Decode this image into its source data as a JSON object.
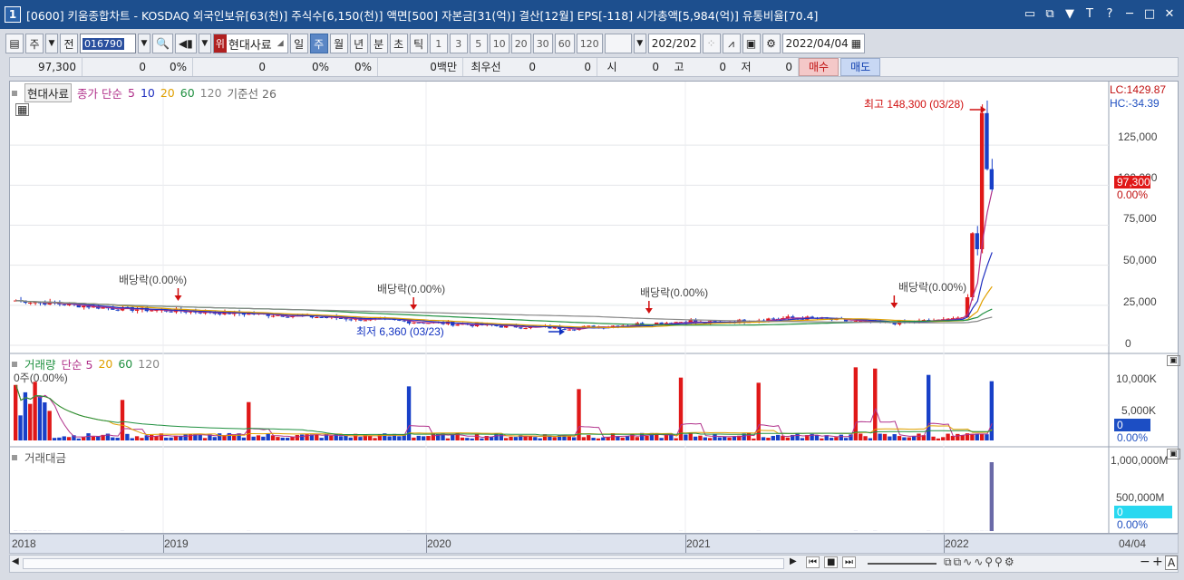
{
  "window": {
    "number": "1",
    "title": "[0600] 키움종합차트 - KOSDAQ 외국인보유[63(천)] 주식수[6,150(천)] 액면[500] 자본금[31(억)] 결산[12월] EPS[-118] 시가총액[5,984(억)] 유통비율[70.4]",
    "controls": [
      "▭",
      "⧉",
      "▼",
      "T",
      "?",
      "─",
      "□",
      "✕"
    ]
  },
  "toolbar": {
    "type_label": "주",
    "prev_label": "전",
    "code_value": "016790",
    "stock_badge": "위",
    "stock_name": "현대사료",
    "periods": [
      "일",
      "주",
      "월",
      "년",
      "분",
      "초",
      "틱"
    ],
    "active_period": "주",
    "multipliers": [
      "1",
      "3",
      "5",
      "10",
      "20",
      "30",
      "60",
      "120"
    ],
    "count": "202",
    "count_total": "/202",
    "date": "2022/04/04"
  },
  "quote": {
    "price": "97,300",
    "change1": "0",
    "pct1": "0%",
    "vol": "0",
    "pct2": "0%",
    "pct3": "0%",
    "amount": "0백만",
    "best_label": "최우선",
    "best1": "0",
    "best2": "0",
    "open_label": "시",
    "open": "0",
    "high_label": "고",
    "high": "0",
    "low_label": "저",
    "low": "0",
    "buy": "매수",
    "sell": "매도"
  },
  "price_panel": {
    "name": "현대사료",
    "legend": [
      {
        "label": "종가 단순",
        "color": "#b0308a"
      },
      {
        "label": "5",
        "color": "#b0308a"
      },
      {
        "label": "10",
        "color": "#2030c0"
      },
      {
        "label": "20",
        "color": "#e0a000"
      },
      {
        "label": "60",
        "color": "#209040"
      },
      {
        "label": "120",
        "color": "#888888"
      },
      {
        "label": "기준선 26",
        "color": "#666666"
      }
    ],
    "lc": "LC:1429.87",
    "hc": "HC:-34.39",
    "current_tag": "97,300",
    "current_pct": "0.00%",
    "high_annot": "최고 148,300 (03/28)",
    "low_annot": "최저 6,360 (03/23)",
    "dividend_label": "배당락(0.00%)",
    "y_ticks": [
      "125,000",
      "100,000",
      "75,000",
      "50,000",
      "25,000",
      "0"
    ],
    "ex_dividend_x": [
      0.14,
      0.38,
      0.62,
      0.87
    ]
  },
  "volume_panel": {
    "name": "거래량",
    "legend": [
      {
        "label": "단순 5",
        "color": "#b0308a"
      },
      {
        "label": "20",
        "color": "#e0a000"
      },
      {
        "label": "60",
        "color": "#209040"
      },
      {
        "label": "120",
        "color": "#888888"
      }
    ],
    "info": "0주(0.00%)",
    "y_ticks": [
      "10,000K",
      "5,000K"
    ],
    "current_tag": "0",
    "current_pct": "0.00%"
  },
  "amount_panel": {
    "name": "거래대금",
    "y_ticks": [
      "1,000,000M",
      "500,000M"
    ],
    "current_tag": "0",
    "current_pct": "0.00%"
  },
  "time_axis": {
    "labels": [
      "2018",
      "2019",
      "2020",
      "2021",
      "2022"
    ],
    "end_label": "04/04"
  },
  "chart_data": {
    "type": "candlestick",
    "title": "",
    "period": "weekly",
    "ylim": [
      0,
      150000
    ],
    "key_points": [
      {
        "x": "2018-01",
        "close": 28000
      },
      {
        "x": "2018-06",
        "close": 24000
      },
      {
        "x": "2019-01",
        "close": 21000
      },
      {
        "x": "2019-08",
        "close": 14000
      },
      {
        "x": "2020-03-23",
        "low": 6360
      },
      {
        "x": "2020-09",
        "close": 15000
      },
      {
        "x": "2021-06",
        "close": 17000
      },
      {
        "x": "2022-01",
        "close": 16000
      },
      {
        "x": "2022-03-28",
        "high": 148300
      },
      {
        "x": "2022-04-04",
        "close": 97300
      }
    ]
  }
}
